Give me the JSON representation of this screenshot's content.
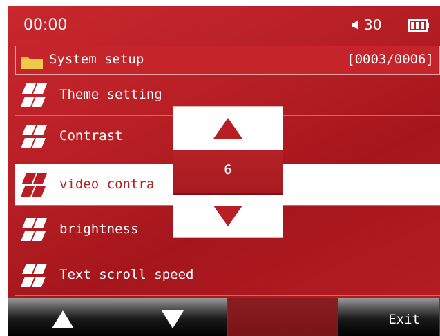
{
  "status": {
    "time": "00:00",
    "volume": "30",
    "icons": {
      "volume": "speaker-icon",
      "battery": "battery-icon"
    }
  },
  "header": {
    "title": "System setup",
    "counter": "[0003/0006]",
    "icon": "folder-icon"
  },
  "menu": {
    "items": [
      {
        "label": "Theme setting"
      },
      {
        "label": "Contrast"
      },
      {
        "label": "video contra"
      },
      {
        "label": "brightness"
      },
      {
        "label": "Text scroll speed"
      }
    ],
    "selected_index": 2,
    "item_icon": "menu-item-icon"
  },
  "popup": {
    "value": "6",
    "up_icon": "triangle-up-icon",
    "down_icon": "triangle-down-icon"
  },
  "bottom_bar": {
    "up_icon": "triangle-up-icon",
    "down_icon": "triangle-down-icon",
    "exit_label": "Exit"
  },
  "colors": {
    "accent": "#b71f25",
    "highlight": "#ffffff"
  }
}
